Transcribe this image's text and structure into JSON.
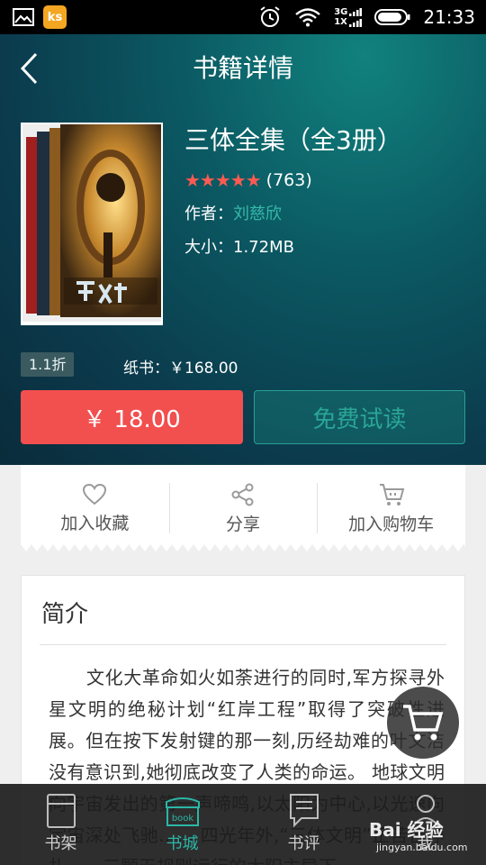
{
  "status_bar": {
    "app_badge": "ks",
    "network_top": "3G",
    "network_bottom": "1X",
    "time": "21:33"
  },
  "header": {
    "title": "书籍详情"
  },
  "book": {
    "title": "三体全集（全3册）",
    "stars": "★★★★★",
    "rating_count": "(763)",
    "author_label": "作者：",
    "author_name": "刘慈欣",
    "size_label": "大小：",
    "size_value": "1.72MB",
    "discount": "1.1折",
    "paper_label": "纸书：",
    "paper_price": "￥168.00"
  },
  "buttons": {
    "buy": "￥ 18.00",
    "trial": "免费试读"
  },
  "actions": {
    "favorite": "加入收藏",
    "share": "分享",
    "cart": "加入购物车"
  },
  "intro": {
    "title": "简介",
    "text": "文化大革命如火如荼进行的同时,军方探寻外星文明的绝秘计划“红岸工程”取得了突破性进展。但在按下发射键的那一刻,历经劫难的叶文洁没有意识到,她彻底改变了人类的命运。 地球文明向宇宙发出的第一声啼鸣,以太阳为中心,以光速向宇宙深处飞驰…… 四光年外,“三体文明”正苦苦挣扎——三颗无规则运行的太阳主导下"
  },
  "tabs": {
    "shelf": "书架",
    "store": "书城",
    "review": "书评",
    "me": "我"
  },
  "watermark": {
    "main": "Bai 经验",
    "sub": "jingyan.baidu.com"
  },
  "colors": {
    "accent": "#2bb6a6",
    "buy": "#f24f4f",
    "star": "#ff5a52"
  }
}
